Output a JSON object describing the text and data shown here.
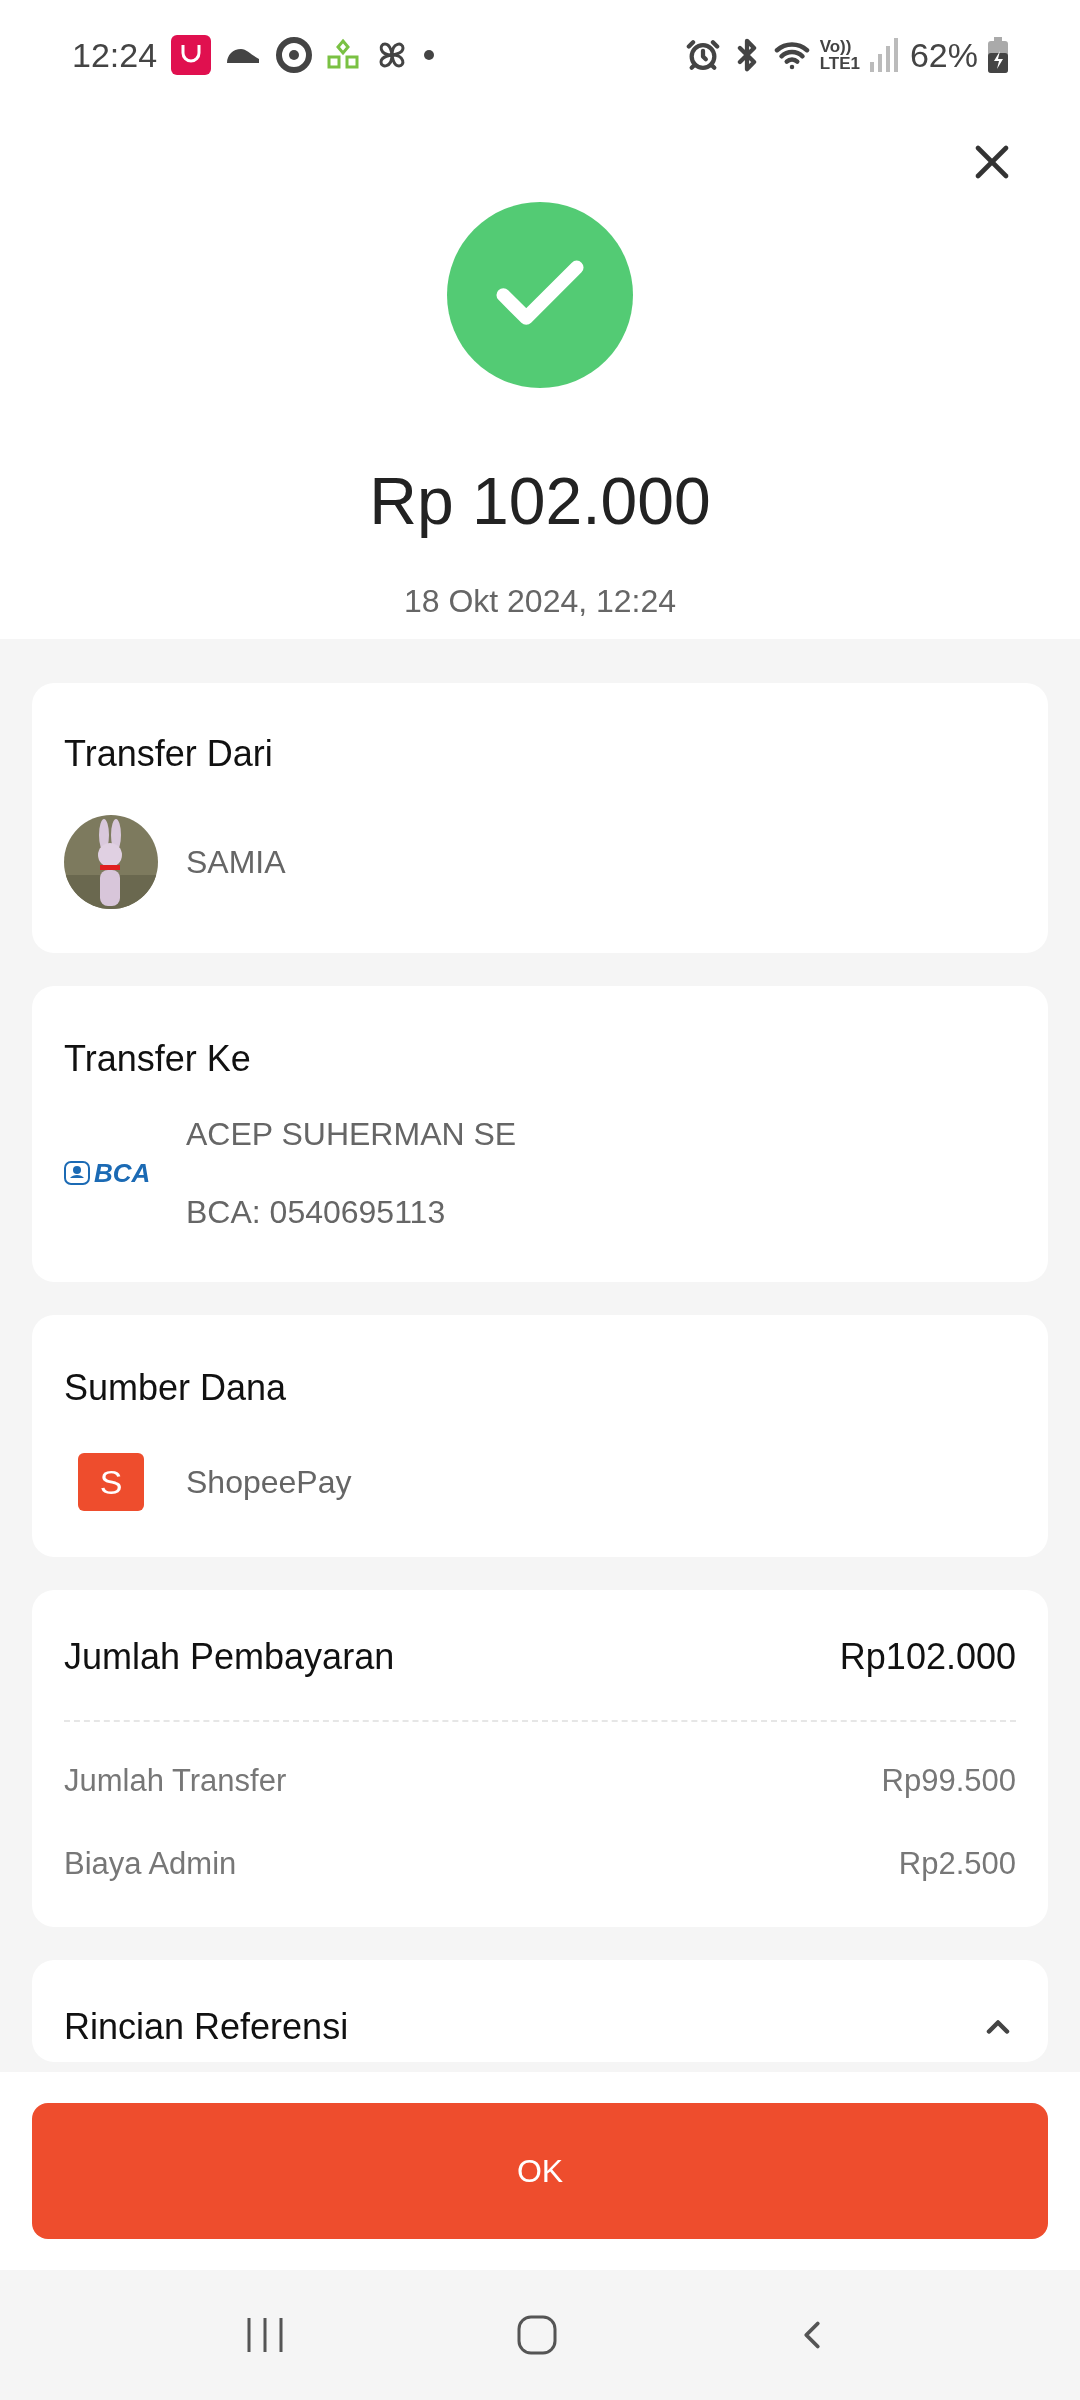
{
  "status_bar": {
    "time": "12:24",
    "network_label_top": "Vo))",
    "network_label_bottom": "LTE1",
    "battery": "62%"
  },
  "amount": "Rp 102.000",
  "date": "18 Okt 2024, 12:24",
  "transfer_from": {
    "title": "Transfer Dari",
    "name": "SAMIA"
  },
  "transfer_to": {
    "title": "Transfer Ke",
    "bank_logo": "BCA",
    "name": "ACEP SUHERMAN SE",
    "account": "BCA: 0540695113"
  },
  "source": {
    "title": "Sumber Dana",
    "wallet_letter": "S",
    "name": "ShopeePay"
  },
  "payment": {
    "title": "Jumlah Pembayaran",
    "total": "Rp102.000",
    "rows": [
      {
        "label": "Jumlah Transfer",
        "value": "Rp99.500"
      },
      {
        "label": "Biaya Admin",
        "value": "Rp2.500"
      }
    ]
  },
  "reference": {
    "title": "Rincian Referensi",
    "expanded": true
  },
  "ok_button": "OK"
}
